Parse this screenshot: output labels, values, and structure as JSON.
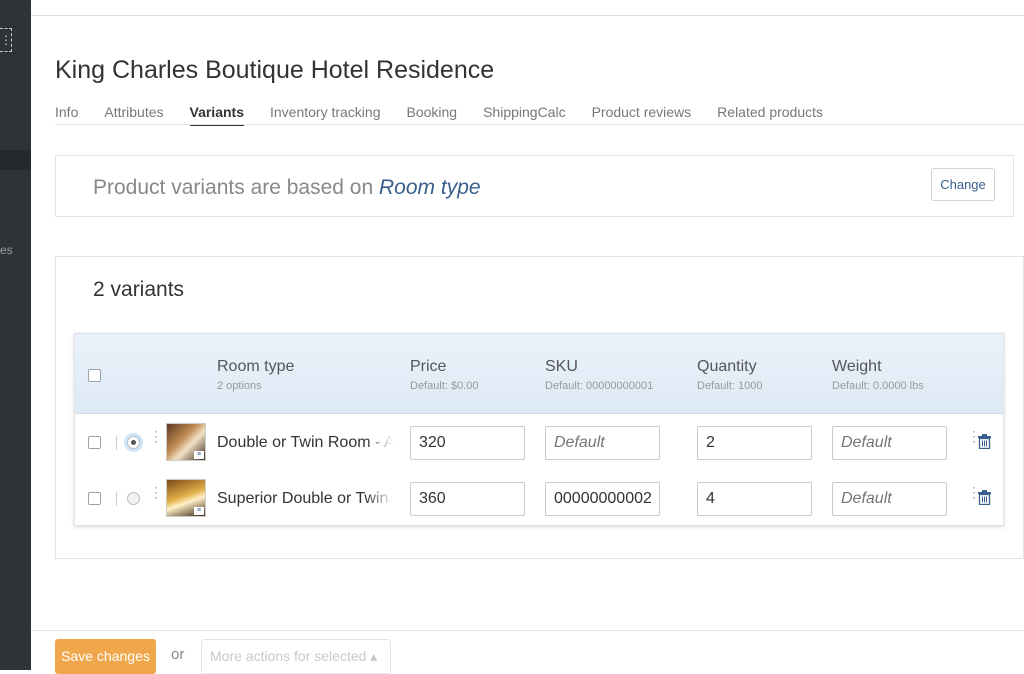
{
  "sidebar": {
    "expand_glyph": "⋮",
    "partial_label": "es"
  },
  "product": {
    "title": "King Charles Boutique Hotel Residence"
  },
  "tabs": [
    {
      "label": "Info"
    },
    {
      "label": "Attributes"
    },
    {
      "label": "Variants",
      "active": true
    },
    {
      "label": "Inventory tracking"
    },
    {
      "label": "Booking"
    },
    {
      "label": "ShippingCalc"
    },
    {
      "label": "Product reviews"
    },
    {
      "label": "Related products"
    }
  ],
  "basis": {
    "prefix": "Product variants are based on",
    "attribute": "Room type",
    "change_label": "Change"
  },
  "variants": {
    "count_label": "2 variants",
    "columns": {
      "room_type": {
        "name": "Room type",
        "sub": "2 options"
      },
      "price": {
        "name": "Price",
        "sub": "Default: $0.00"
      },
      "sku": {
        "name": "SKU",
        "sub": "Default: 00000000001"
      },
      "quantity": {
        "name": "Quantity",
        "sub": "Default: 1000"
      },
      "weight": {
        "name": "Weight",
        "sub": "Default: 0.0000 lbs"
      }
    },
    "rows": [
      {
        "room_type": "Double or Twin Room - Annex",
        "price": "320",
        "sku_placeholder": "Default",
        "sku": "",
        "quantity": "2",
        "weight_placeholder": "Default",
        "default": true
      },
      {
        "room_type": "Superior Double or Twin Room",
        "price": "360",
        "sku_placeholder": "Default",
        "sku": "00000000002",
        "quantity": "4",
        "weight_placeholder": "Default",
        "default": false
      }
    ]
  },
  "footer": {
    "save_label": "Save changes",
    "or_label": "or",
    "more_actions_label": "More actions for selected ▴"
  },
  "colors": {
    "accent": "#f0a64a",
    "link": "#3a5e8c",
    "sidebar": "#2f3338"
  }
}
